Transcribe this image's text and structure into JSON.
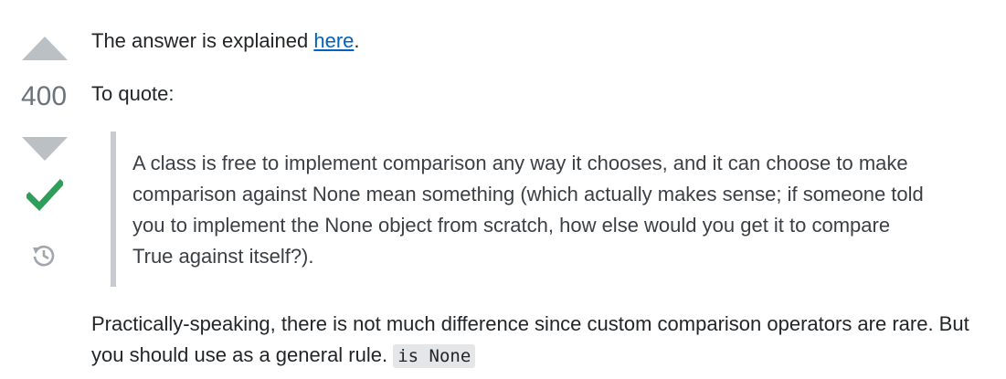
{
  "vote": {
    "score": "400",
    "accepted": true
  },
  "post": {
    "para1_prefix": "The answer is explained ",
    "para1_link": "here",
    "para1_suffix": ".",
    "para2": "To quote:",
    "quote_lines": [
      "A class is free to implement comparison any way it chooses, and it can choose to make",
      "comparison against None mean something (which actually makes sense; if someone told",
      "you to implement the None object from scratch, how else would you get it to compare",
      "True against itself?)."
    ],
    "para3_line1": "Practically-speaking, there is not much difference since custom comparison operators are rare. But",
    "para3_line2": "you should use as a general rule. ",
    "para3_code": "is None"
  },
  "colors": {
    "vote_arrow": "#bbc0c4",
    "accepted_check": "#2f9e5a",
    "history_icon": "#9fa6ad",
    "link": "#0063bf",
    "quote_bar": "#c8ccd0"
  }
}
